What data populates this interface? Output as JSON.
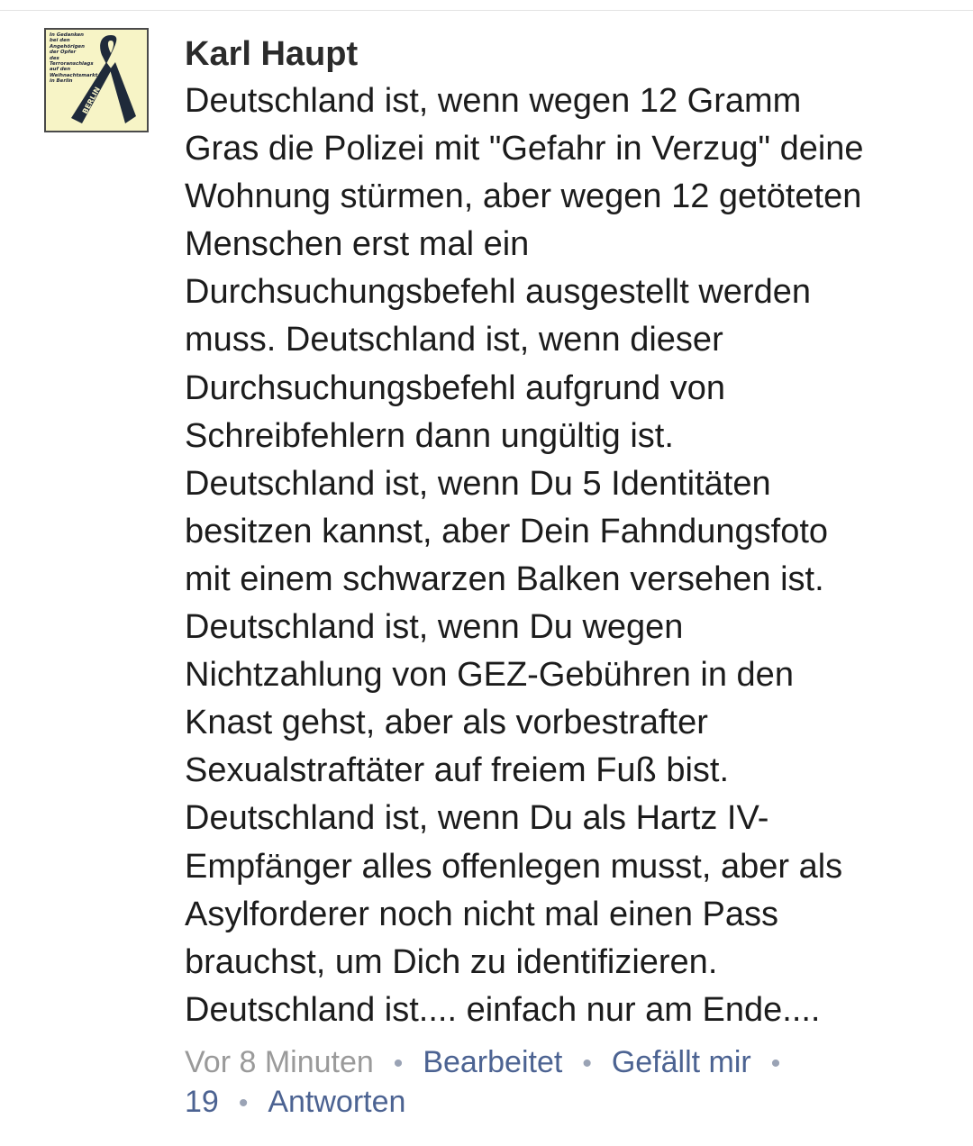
{
  "comment": {
    "avatar_caption": "In Gedanken\nbei den\nAngehörigen\nder Opfer\ndes\nTerroranschlags\nauf den\nWeihnachtsmarkt\nin Berlin",
    "avatar_ribbon_word": "BERLIN",
    "author": "Karl Haupt",
    "text_lines": [
      "Deutschland ist, wenn wegen 12 Gramm",
      "Gras die Polizei mit \"Gefahr in Verzug\" deine",
      "Wohnung stürmen, aber wegen 12 getöteten",
      "Menschen erst mal ein",
      "Durchsuchungsbefehl ausgestellt werden",
      "muss. Deutschland ist, wenn dieser",
      "Durchsuchungsbefehl aufgrund von",
      "Schreibfehlern dann ungültig ist.",
      "Deutschland ist, wenn Du 5 Identitäten",
      "besitzen kannst, aber Dein Fahndungsfoto",
      "mit einem schwarzen Balken versehen ist.",
      "Deutschland ist, wenn Du wegen",
      "Nichtzahlung von GEZ-Gebühren in den",
      "Knast gehst, aber als vorbestrafter",
      "Sexualstraftäter auf freiem Fuß bist.",
      "Deutschland ist, wenn Du als Hartz IV-",
      "Empfänger alles offenlegen musst, aber als",
      "Asylforderer noch nicht mal einen Pass",
      "brauchst, um Dich zu identifizieren.",
      "Deutschland ist.... einfach nur am Ende...."
    ],
    "meta": {
      "timestamp": "Vor 8 Minuten",
      "edited_label": "Bearbeitet",
      "like_label": "Gefällt mir",
      "like_count": "19",
      "reply_label": "Antworten",
      "separator": "•"
    }
  }
}
